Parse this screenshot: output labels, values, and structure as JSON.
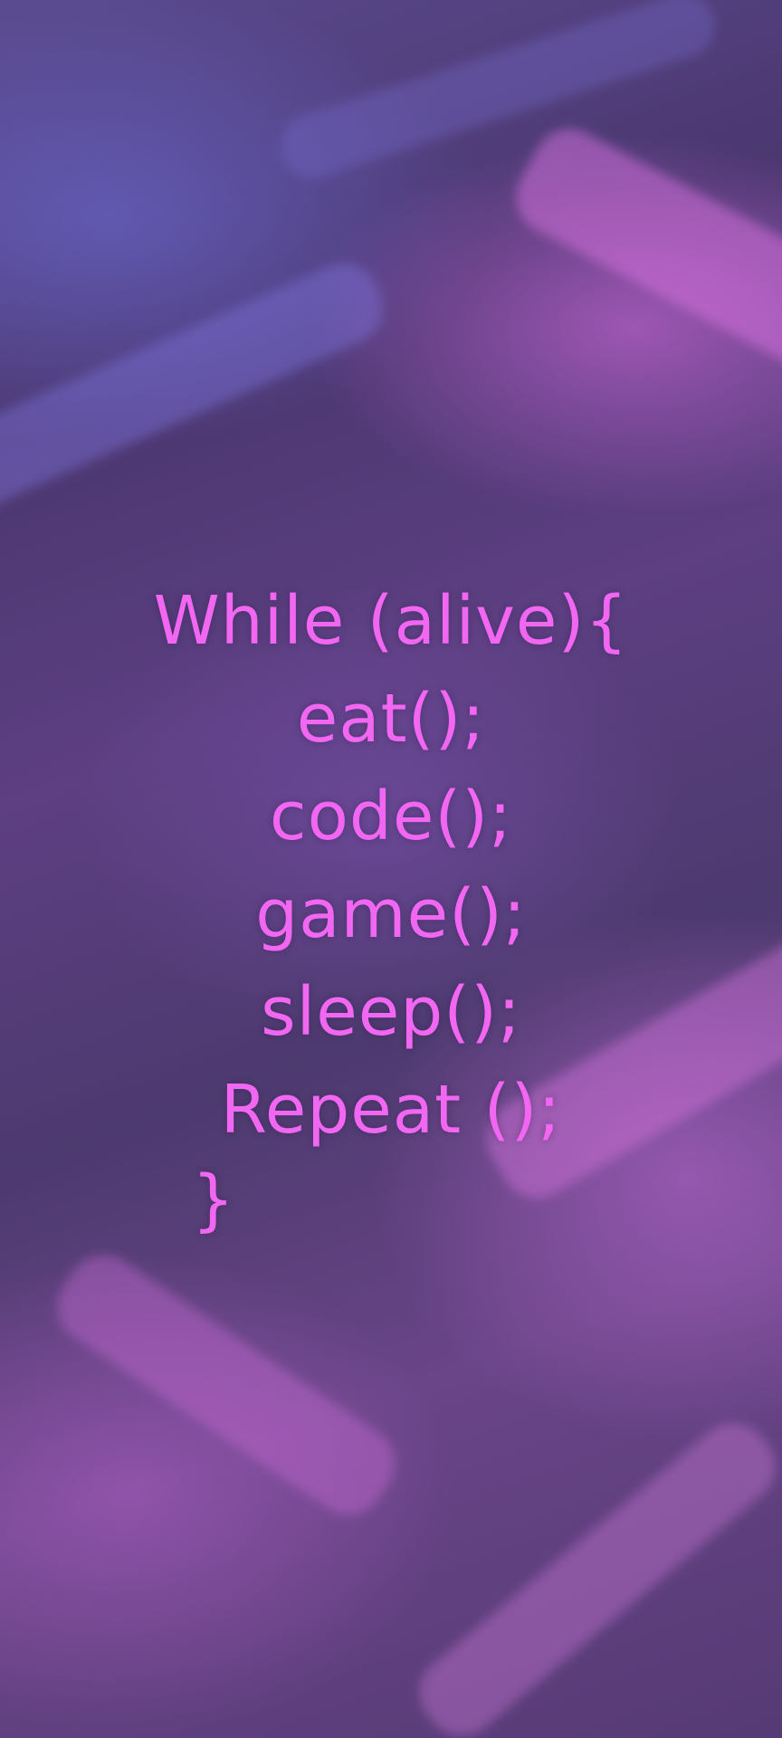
{
  "background": {
    "description_colors": [
      "#4b3770",
      "#6a4588",
      "#e06ee6",
      "#6e6edc"
    ]
  },
  "code": {
    "color": "#f267f2",
    "lines": [
      "While (alive){",
      "eat();",
      "code();",
      "game();",
      "sleep();",
      "Repeat ();",
      "}"
    ]
  }
}
